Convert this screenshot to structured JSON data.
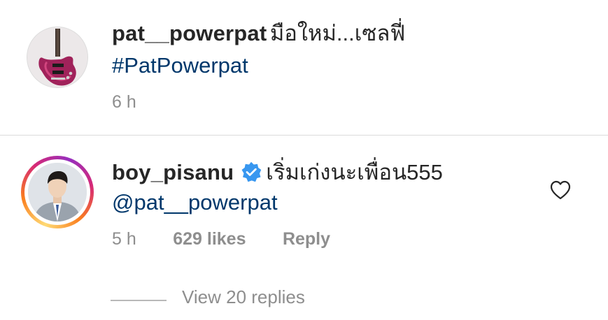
{
  "caption": {
    "username": "pat__powerpat",
    "text": "มือใหม่...เซลฟี่",
    "hashtag": "#PatPowerpat",
    "time": "6 h",
    "avatar_icon": "guitar-icon"
  },
  "reply": {
    "username": "boy_pisanu",
    "verified_icon": "verified-badge-icon",
    "text": "เริ่มเก่งนะเพื่อน555",
    "mention": "@pat__powerpat",
    "time": "5 h",
    "likes": "629 likes",
    "reply_label": "Reply",
    "like_icon": "heart-outline-icon",
    "view_replies": "View 20 replies"
  },
  "colors": {
    "text": "#262626",
    "link": "#00376b",
    "meta": "#8e8e8e",
    "verified": "#3897f0",
    "divider": "#dbdbdb"
  }
}
